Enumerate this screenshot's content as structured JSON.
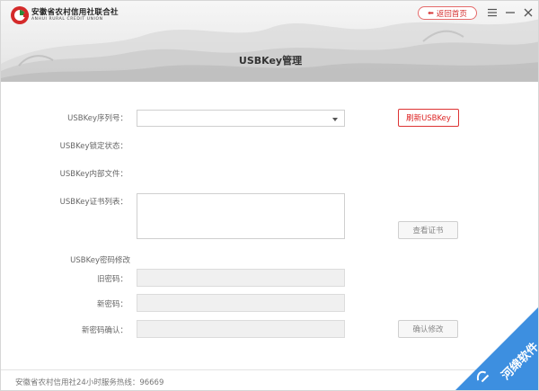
{
  "logo": {
    "cn": "安徽省农村信用社联合社",
    "en": "ANHUI RURAL CREDIT UNION"
  },
  "header": {
    "home_button": "返回首页",
    "title": "USBKey管理"
  },
  "form": {
    "serial_label": "USBKey序列号：",
    "serial_value": "",
    "lock_label": "USBKey锁定状态：",
    "files_label": "USBKey内部文件：",
    "certs_label": "USBKey证书列表：",
    "refresh_button": "刷新USBKey",
    "view_cert_button": "查看证书",
    "pwd_section_label": "USBKey密码修改",
    "old_pwd_label": "旧密码：",
    "new_pwd_label": "新密码：",
    "confirm_pwd_label": "新密码确认：",
    "confirm_button": "确认修改"
  },
  "footer": {
    "hotline": "安徽省农村信用社24小时服务热线：96669"
  },
  "watermark": {
    "text": "河绵软件"
  },
  "colors": {
    "accent_red": "#d33333",
    "watermark_blue": "#3d8fe0"
  }
}
